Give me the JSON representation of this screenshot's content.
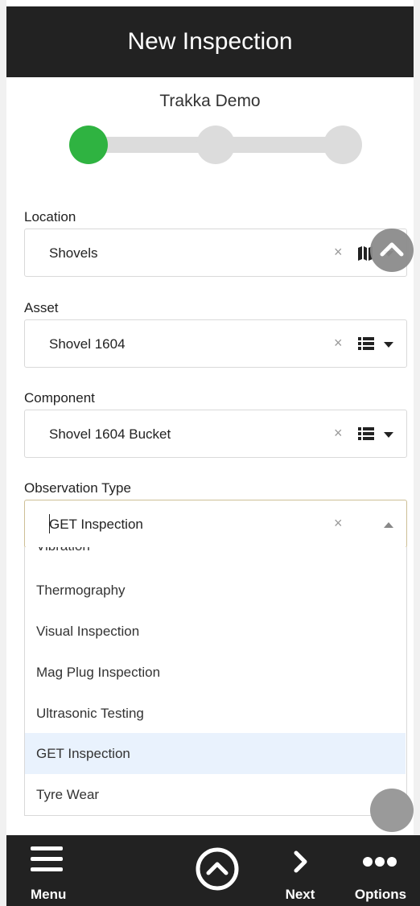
{
  "header": {
    "title": "New Inspection"
  },
  "subtitle": "Trakka Demo",
  "stepper": {
    "total_steps": 3,
    "current_step": 1,
    "active_color": "#2fb341",
    "inactive_color": "#dcdcdc"
  },
  "form": {
    "location": {
      "label": "Location",
      "value": "Shovels",
      "clear": "×",
      "icon": "map-icon"
    },
    "asset": {
      "label": "Asset",
      "value": "Shovel 1604",
      "clear": "×",
      "icon": "list-icon"
    },
    "component": {
      "label": "Component",
      "value": "Shovel 1604 Bucket",
      "clear": "×",
      "icon": "list-icon"
    },
    "observation_type": {
      "label": "Observation Type",
      "value": "GET Inspection",
      "clear": "×",
      "options": [
        "Vibration",
        "Thermography",
        "Visual Inspection",
        "Mag Plug Inspection",
        "Ultrasonic Testing",
        "GET Inspection",
        "Tyre Wear"
      ],
      "selected_option": "GET Inspection"
    }
  },
  "bottom_bar": {
    "menu_label": "Menu",
    "next_label": "Next",
    "options_label": "Options"
  },
  "colors": {
    "header_bg": "#222222",
    "selected_option_bg": "#e9f2fd"
  }
}
